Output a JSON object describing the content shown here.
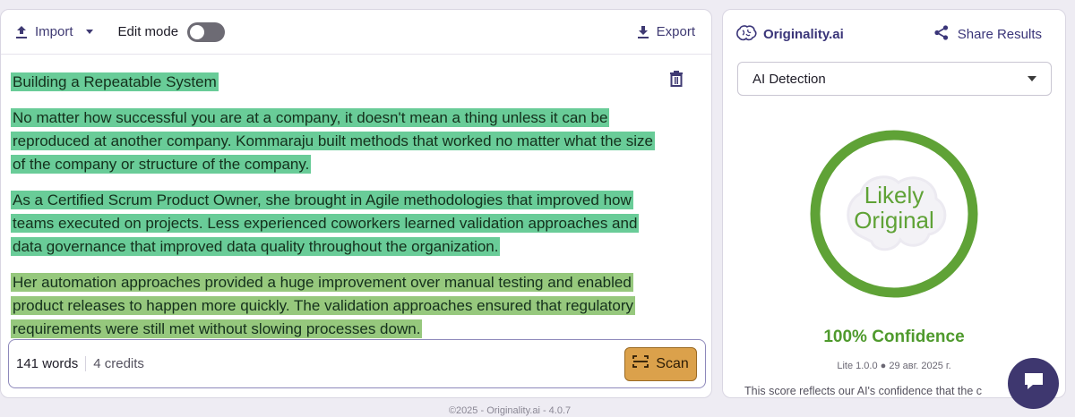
{
  "toolbar": {
    "import_label": "Import",
    "edit_mode_label": "Edit mode",
    "export_label": "Export"
  },
  "document": {
    "paragraphs": [
      {
        "text": "Building a Repeatable System",
        "highlight": "#69cc98"
      },
      {
        "text": "No matter how successful you are at a company, it doesn't mean a thing unless it can be reproduced at another company.  Kommaraju built methods that worked no matter what the size of the company or structure of the company.",
        "highlight": "#69cc98"
      },
      {
        "text": "As a Certified Scrum Product Owner, she brought in Agile methodologies that improved how teams executed on projects.  Less experienced coworkers learned validation approaches and data governance that improved data quality throughout the organization.",
        "highlight": "#69cc98"
      },
      {
        "text": "Her automation approaches provided a huge improvement over manual testing and enabled product releases to happen more quickly.  The validation approaches ensured that regulatory requirements were still met without slowing processes down.",
        "highlight": "#96c87d"
      }
    ]
  },
  "status": {
    "words": "141 words",
    "credits": "4 credits",
    "scan_label": "Scan"
  },
  "results": {
    "brand": "Originality.ai",
    "share_label": "Share Results",
    "detection_select": "AI Detection",
    "gauge_line1": "Likely",
    "gauge_line2": "Original",
    "gauge_color": "#5fa236",
    "confidence": "100% Confidence",
    "version": "Lite 1.0.0 ● 29 авг. 2025 г.",
    "note": "This score reflects our AI's confidence that the c"
  },
  "footer": "©2025 - Originality.ai - 4.0.7",
  "icons": {
    "import": "upload-icon",
    "export": "download-icon",
    "delete": "trash-icon",
    "scan": "scan-icon",
    "brand": "brain-icon",
    "share": "share-icon",
    "chat": "chat-icon"
  }
}
